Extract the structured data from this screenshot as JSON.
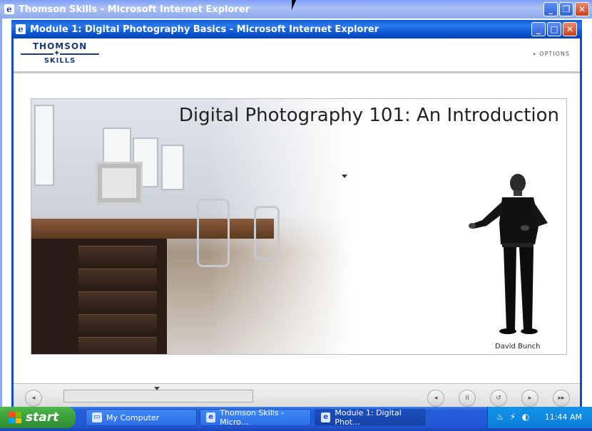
{
  "outer_window": {
    "title": "Thomson Skills - Microsoft Internet Explorer",
    "icon": "ie-icon"
  },
  "inner_window": {
    "title": "Module 1: Digital Photography Basics - Microsoft Internet Explorer",
    "icon": "ie-icon"
  },
  "window_controls": {
    "minimize": "_",
    "restore": "❐",
    "maximize": "□",
    "close": "✕"
  },
  "header": {
    "logo_top": "THOMSON",
    "logo_bottom": "SKILLS",
    "options_label": "OPTIONS"
  },
  "stage": {
    "title": "Digital Photography 101: An Introduction",
    "presenter_name": "David Bunch"
  },
  "controls": {
    "buttons": [
      "◂",
      "II",
      "↺",
      "▸",
      "▸▸"
    ]
  },
  "taskbar": {
    "start_label": "start",
    "tasks": [
      {
        "label": "My Computer",
        "icon": "computer-icon"
      },
      {
        "label": "Thomson Skills - Micro…",
        "icon": "ie-icon"
      },
      {
        "label": "Module 1: Digital Phot…",
        "icon": "ie-icon"
      }
    ],
    "clock": "11:44 AM"
  },
  "colors": {
    "title_active": "#0a5bd6",
    "taskbar": "#245edb",
    "start": "#3aa03a"
  }
}
